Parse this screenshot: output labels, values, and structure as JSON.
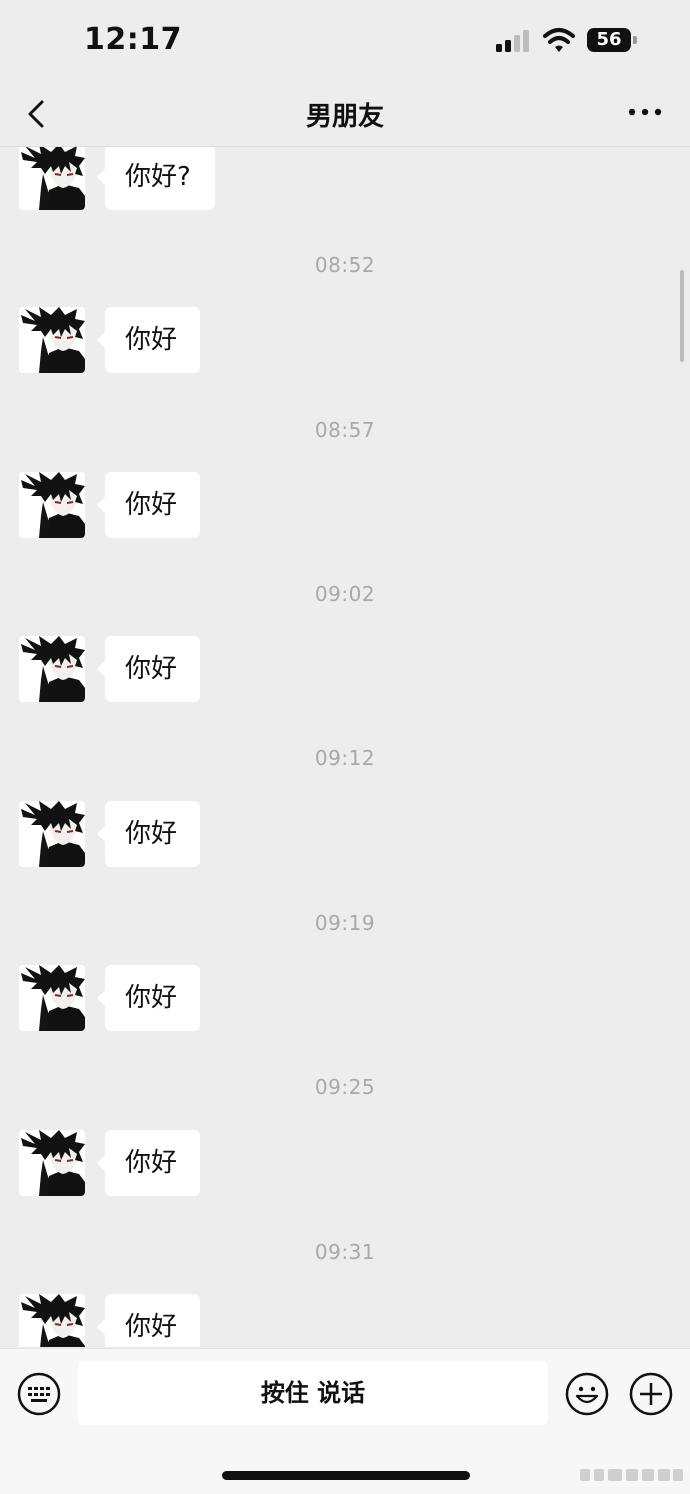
{
  "status": {
    "time": "12:17",
    "battery": "56",
    "signal_icon": "cellular-signal-icon",
    "wifi_icon": "wifi-icon"
  },
  "nav": {
    "title": "男朋友",
    "back_icon": "chevron-left-icon",
    "more_icon": "ellipsis-icon"
  },
  "messages": [
    {
      "text": "你好?"
    },
    {
      "time": "08:52",
      "text": "你好"
    },
    {
      "time": "08:57",
      "text": "你好"
    },
    {
      "time": "09:02",
      "text": "你好"
    },
    {
      "time": "09:12",
      "text": "你好"
    },
    {
      "time": "09:19",
      "text": "你好"
    },
    {
      "time": "09:25",
      "text": "你好"
    },
    {
      "time": "09:31",
      "text": "你好"
    }
  ],
  "input_bar": {
    "hold_to_talk": "按住 说话",
    "keyboard_icon": "keyboard-icon",
    "emoji_icon": "emoji-icon",
    "plus_icon": "plus-circle-icon"
  },
  "colors": {
    "background": "#ededed",
    "bubble": "#ffffff",
    "timestamp": "#a8a8a8"
  }
}
